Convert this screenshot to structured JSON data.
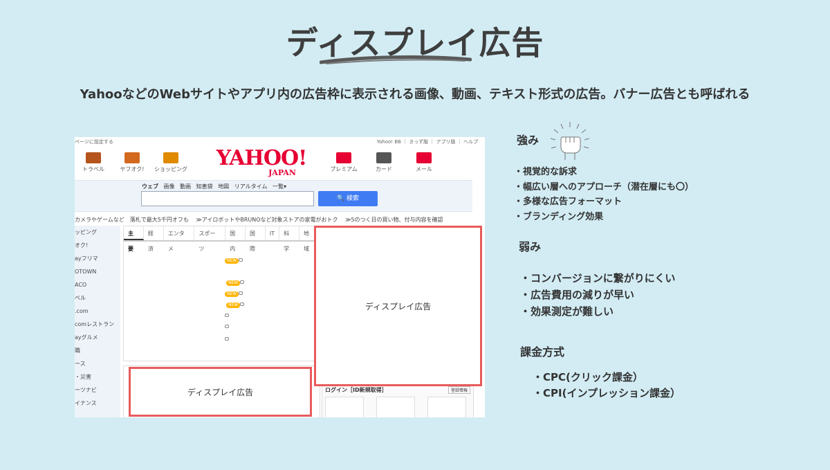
{
  "title": "ディスプレイ広告",
  "subtitle": "YahooなどのWebサイトやアプリ内の広告枠に表示される画像、動画、テキスト形式の広告。バナー広告とも呼ばれる",
  "screenshot": {
    "top_left_link": "ページに設定する",
    "top_right_links": "Yahoo! BB ｜ きっず版 ｜ アプリ版 ｜ ヘルプ",
    "services": [
      {
        "label": "トラベル",
        "color": "#b5541c"
      },
      {
        "label": "ヤフオク!",
        "color": "#d2691e"
      },
      {
        "label": "ショッピング",
        "color": "#e08a00"
      },
      {
        "label": "プレミアム",
        "color": "#e60033"
      },
      {
        "label": "カード",
        "color": "#555555"
      },
      {
        "label": "メール",
        "color": "#e60033"
      }
    ],
    "logo_text": "YAHOO!",
    "logo_sub": "JAPAN",
    "search_tabs": [
      "ウェブ",
      "画像",
      "動画",
      "知恵袋",
      "地図",
      "リアルタイム",
      "一覧▾"
    ],
    "search_button": "🔍 検索",
    "news_line": "カメラやゲームなど　落札で最大5千円オフも　 ≫アイロボットやBRUNOなど対象ストアの家電がおトク　 ≫5のつく日の買い物、付与内容を確認",
    "sidebar_items": [
      "ッピング",
      "オク!",
      "ayフリマ",
      "OTOWN",
      "ACO",
      "ベル",
      ".com",
      "comレストラン",
      "ayグルメ",
      "職",
      "ース",
      "・災害",
      "ーツナビ",
      "イナンス"
    ],
    "news_tabs": [
      "主要",
      "経済",
      "エンタメ",
      "スポーツ",
      "国内",
      "国際",
      "IT",
      "科学",
      "地域"
    ],
    "new_badge": "NEW",
    "login_title": "ログイン［ID新規取得］",
    "login_button": "登録情報",
    "ad_big_label": "ディスプレイ広告",
    "ad_small_label": "ディスプレイ広告"
  },
  "strengths": {
    "heading": "強み",
    "items": [
      "・視覚的な訴求",
      "・幅広い層へのアプローチ（潜在層にも〇）",
      "・多様な広告フォーマット",
      "・ブランディング効果"
    ]
  },
  "weaknesses": {
    "heading": "弱み",
    "items": [
      "・コンバージョンに繋がりにくい",
      "・広告費用の減りが早い",
      "・効果測定が難しい"
    ]
  },
  "billing": {
    "heading": "課金方式",
    "items": [
      "・CPC(クリック課金）",
      "・CPI(インプレッション課金）"
    ]
  }
}
